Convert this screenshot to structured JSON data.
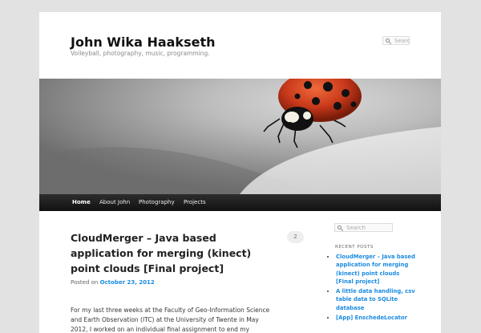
{
  "site": {
    "title": "John Wika Haakseth",
    "description": "Volleyball, photography, music, programming."
  },
  "search": {
    "header_placeholder": "Search",
    "sidebar_placeholder": "Search"
  },
  "nav": {
    "items": [
      "Home",
      "About John",
      "Photography",
      "Projects"
    ],
    "active": "Home"
  },
  "post": {
    "title": "CloudMerger – Java based application for merging (kinect) point clouds [Final project]",
    "comment_count": "2",
    "posted_on_label": "Posted on",
    "date": "October 23, 2012",
    "excerpt": "For my last three weeks at the Faculty of Geo-Information Science and Earth Observation (ITC) at the University of Twente in May 2012, I worked on an individual final assignment to end my program, Post-Graduate Diploma of"
  },
  "sidebar": {
    "recent_heading": "RECENT POSTS",
    "recent_posts": [
      "CloudMerger – Java based application for merging (kinect) point clouds [Final project]",
      "A little data handling, csv table data to SQLite database",
      "[App] EnschedeLocator"
    ]
  },
  "header_image": {
    "subject": "ladybug on grey surface",
    "colors": {
      "ladybug_red": "#c8391b",
      "spots": "#111111",
      "background_grey": "#8a8a8a"
    }
  },
  "colors": {
    "link": "#1b8be0",
    "nav_bg": "#1d1d1d",
    "page_bg": "#e2e2e2"
  }
}
